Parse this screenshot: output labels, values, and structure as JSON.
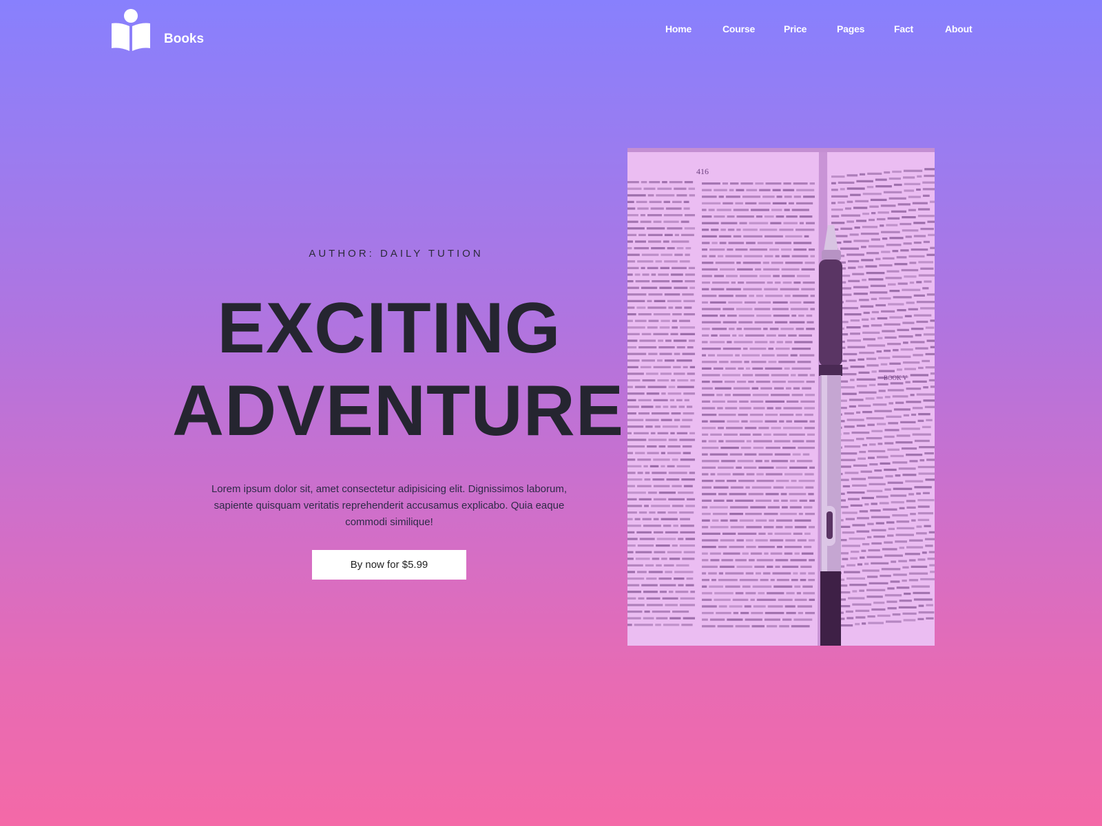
{
  "brand": {
    "name": "Books",
    "icon": "book-reader-icon"
  },
  "nav": {
    "items": [
      "Home",
      "Course",
      "Price",
      "Pages",
      "Fact",
      "About"
    ]
  },
  "hero": {
    "author": "AUTHOR: DAILY TUTION",
    "title_line1": "EXCITING",
    "title_line2": "ADVENTURE",
    "description": "Lorem ipsum dolor sit, amet consectetur adipisicing elit. Dignissimos laborum, sapiente quisquam veritatis reprehenderit accusamus explicabo. Quia eaque commodi similique!",
    "cta_label": "By now for $5.99"
  },
  "photo": {
    "subject": "open-book-with-pen",
    "page_number": "416",
    "book_heading": "BOOK V"
  },
  "colors": {
    "gradient_top": "#8880fd",
    "gradient_bottom": "#f469a7",
    "title_text": "#252530",
    "photo_tint": "#e7b6f0"
  }
}
